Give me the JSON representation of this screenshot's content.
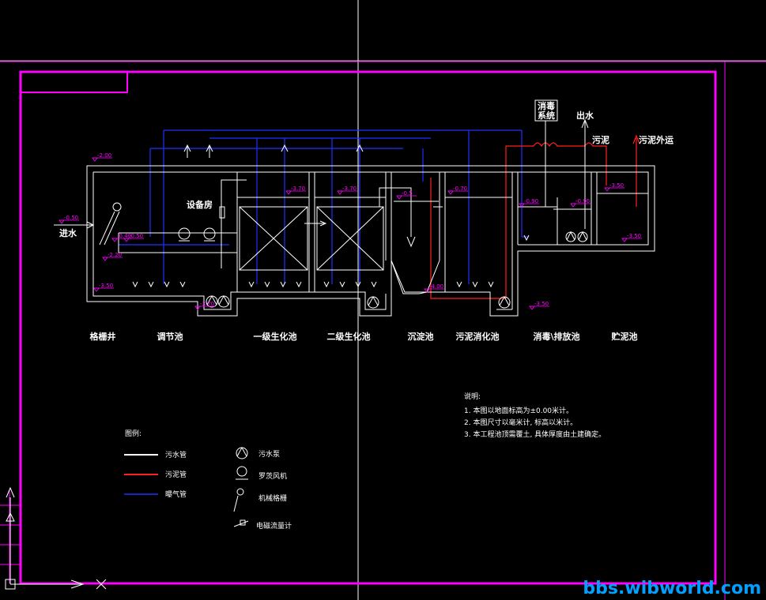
{
  "labels": {
    "inflow": "进水",
    "equipment_room": "设备房",
    "disinfection_system": [
      "消毒",
      "系统"
    ],
    "outflow": "出水",
    "sludge": "污泥",
    "sludge_out": "污泥外运"
  },
  "units": [
    "格栅井",
    "调节池",
    "一级生化池",
    "二级生化池",
    "沉淀池",
    "污泥消化池",
    "消毒\\排放池",
    "贮泥池"
  ],
  "levels": [
    "-2.00",
    "-0.50",
    "-0.40",
    "-2.20",
    "-3.50",
    "-3.70",
    "-3.70",
    "-3.70",
    "-0.5",
    "-0.70",
    "-4.00",
    "-0.90",
    "-0.90",
    "-3.50",
    "-3.50",
    "-3.50",
    "-0.50"
  ],
  "legend": {
    "title": "图例:",
    "items": [
      {
        "name": "污水管",
        "color": "#ffffff"
      },
      {
        "name": "污泥管",
        "color": "#ff0000"
      },
      {
        "name": "曝气管",
        "color": "#0000ff"
      }
    ],
    "symbols": [
      "污水泵",
      "罗茨风机",
      "机械格栅",
      "电磁流量计"
    ]
  },
  "notes": {
    "title": "说明:",
    "lines": [
      "1. 本图以地面标高为±0.00米计。",
      "2. 本图尺寸以毫米计, 标高以米计。",
      "3. 本工程池顶需覆土, 具体厚度由土建确定。"
    ]
  },
  "watermark": "bbs.wibworld.com",
  "colors": {
    "frame": "#ff00ff",
    "water": "#ffffff",
    "sludge": "#ff0000",
    "air": "#0000ff",
    "level": "#ff00ff",
    "watermark": "#00a0ff"
  }
}
